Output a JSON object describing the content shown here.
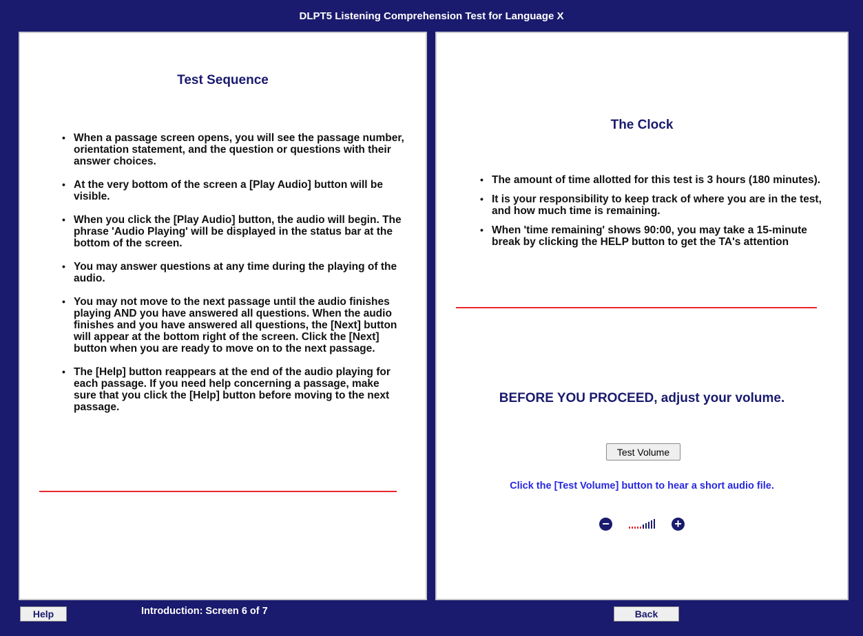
{
  "window": {
    "title": "DLPT5 Listening Comprehension Test for Language X"
  },
  "left_panel": {
    "title": "Test Sequence",
    "bullets": [
      "When a passage screen opens, you will see the passage number, orientation statement, and the question or questions with their answer choices.",
      "At the very bottom of the screen a [Play Audio] button will be visible.",
      "When you click the [Play Audio] button, the audio will begin. The phrase 'Audio Playing' will be displayed in the status bar at the bottom of the screen.",
      "You may answer questions at any time during the playing of the audio.",
      "You may not move to the next passage until the audio finishes playing AND you have answered all questions. When the audio finishes and you have answered all questions, the [Next] button will appear at the bottom right of the screen. Click the [Next] button when you are ready to move on to the next passage.",
      "The [Help] button reappears at the end of the audio playing for each passage. If you need help concerning a passage, make sure that you click the [Help] button before moving to the next passage."
    ]
  },
  "right_panel": {
    "title": "The Clock",
    "bullets": [
      "The amount of time allotted for this test is 3 hours (180 minutes).",
      "It is your responsibility to keep track of where you are in the test, and how much time is remaining.",
      "When 'time remaining' shows 90:00, you may take a 15-minute break by clicking the HELP button to get the TA's attention"
    ],
    "proceed_text": "BEFORE YOU PROCEED, adjust your volume.",
    "test_volume_label": "Test Volume",
    "hint_text": "Click the [Test Volume] button to hear a short audio file.",
    "volume": {
      "decrease_icon": "minus-circle-icon",
      "increase_icon": "plus-circle-icon",
      "level_bars_red": 5,
      "level_bars_total": 10
    }
  },
  "footer": {
    "help_label": "Help",
    "status_text": "Introduction: Screen 6 of 7",
    "back_label": "Back"
  },
  "colors": {
    "frame": "#1a1a6e",
    "heading": "#1a1a6e",
    "divider": "#e8262a",
    "hint": "#2828e0"
  }
}
